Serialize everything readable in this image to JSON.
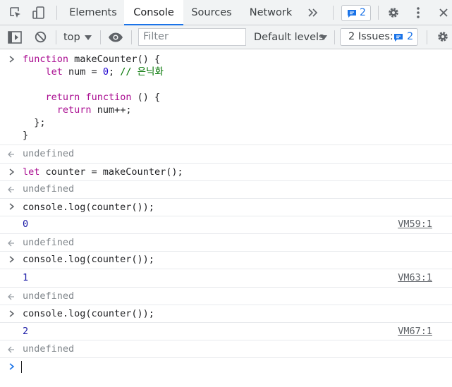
{
  "tabs": [
    "Elements",
    "Console",
    "Sources",
    "Network"
  ],
  "message_badge_count": "2",
  "toolbar": {
    "context": "top",
    "filter_placeholder": "Filter",
    "levels": "Default levels",
    "issues_label": "2 Issues:",
    "issues_count": "2"
  },
  "entries": {
    "e1": {
      "l1_kw": "function",
      "l1_rest": " makeCounter() {",
      "l2_kw": "let",
      "l2_a": " num = ",
      "l2_num": "0",
      "l2_b": "; ",
      "l2_cmt": "// 은닉화",
      "l3_kw1": "return",
      "l3_kw2": "function",
      "l3_rest": " () {",
      "l4_kw": "return",
      "l4_rest": " num++;",
      "l5": "};",
      "l6": "}"
    },
    "r1": "undefined",
    "e2": {
      "kw": "let",
      "rest": " counter = makeCounter();"
    },
    "r2": "undefined",
    "e3": "console.log(counter());",
    "o3": "0",
    "o3_src": "VM59:1",
    "r3": "undefined",
    "e4": "console.log(counter());",
    "o4": "1",
    "o4_src": "VM63:1",
    "r4": "undefined",
    "e5": "console.log(counter());",
    "o5": "2",
    "o5_src": "VM67:1",
    "r5": "undefined"
  },
  "icons": [
    "inspect-element-icon",
    "device-toolbar-icon",
    "more-tabs-icon",
    "chat-icon",
    "gear-icon",
    "kebab-menu-icon",
    "close-icon",
    "sidebar-icon",
    "clear-console-icon",
    "dropdown-caret-icon",
    "eye-icon",
    "prompt-chevron-icon",
    "result-arrow-icon"
  ],
  "colors": {
    "accent": "#1a73e8",
    "keyword": "#aa0d91",
    "number": "#1c00cf",
    "comment": "#007400"
  }
}
